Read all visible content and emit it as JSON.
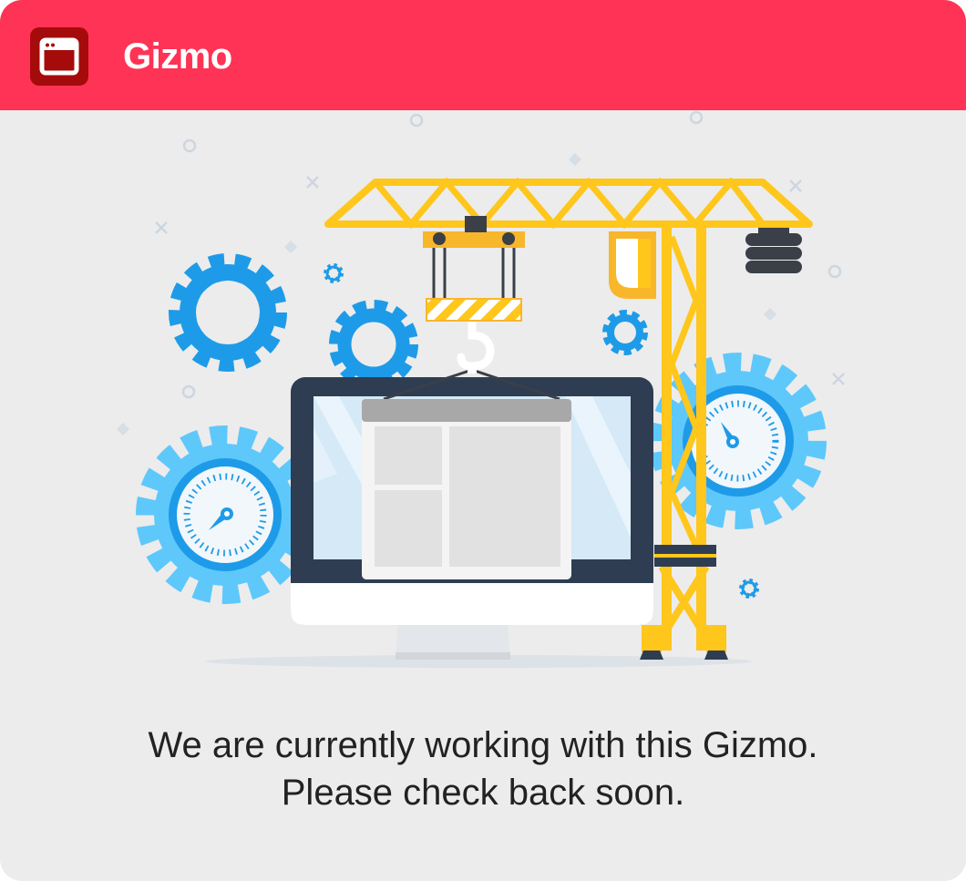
{
  "app": {
    "title": "Gizmo",
    "icon": "browser-window-icon"
  },
  "illustration": {
    "subject": "under-construction-icon"
  },
  "message": {
    "line1": "We are currently working with this Gizmo.",
    "line2": "Please check back soon."
  },
  "colors": {
    "header": "#ff3355",
    "icon_bg": "#a50b0b",
    "background": "#ececec",
    "text": "#222222",
    "gear_dark": "#1e9be8",
    "gear_light": "#5ec8fb",
    "crane": "#ffc61c",
    "monitor": "#2e3d52"
  }
}
